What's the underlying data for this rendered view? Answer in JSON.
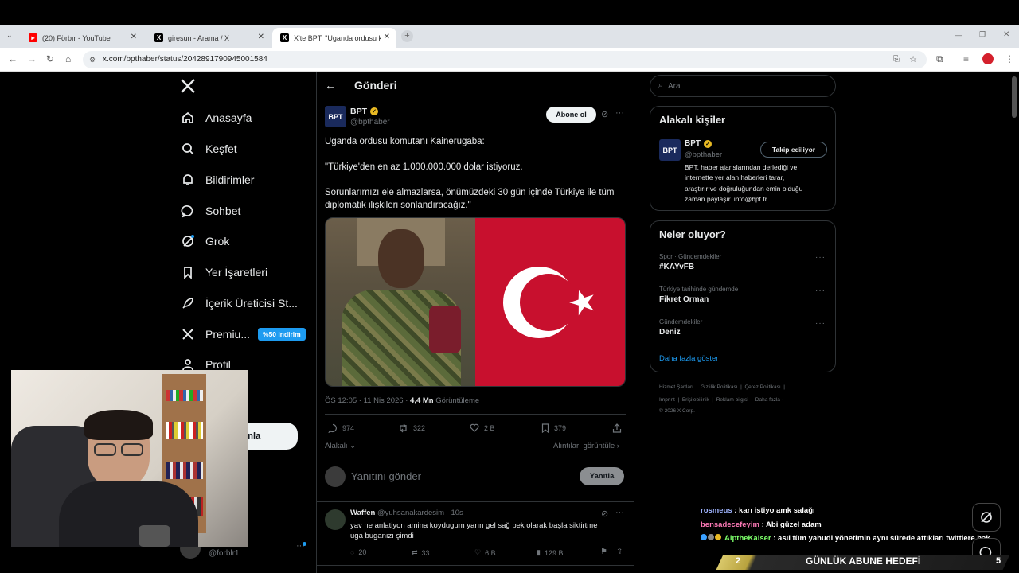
{
  "browser": {
    "tabs": [
      {
        "title": "(20) Förbır - YouTube",
        "icon": "youtube-icon"
      },
      {
        "title": "giresun - Arama / X",
        "icon": "x-icon"
      },
      {
        "title": "X'te BPT: \"Uganda ordusu komu",
        "icon": "x-icon"
      }
    ],
    "url": "x.com/bpthaber/status/2042891790945001584"
  },
  "nav": {
    "items": [
      {
        "label": "Anasayfa",
        "icon": "home-icon"
      },
      {
        "label": "Keşfet",
        "icon": "search-icon"
      },
      {
        "label": "Bildirimler",
        "icon": "bell-icon"
      },
      {
        "label": "Sohbet",
        "icon": "chat-icon"
      },
      {
        "label": "Grok",
        "icon": "grok-icon"
      },
      {
        "label": "Yer İşaretleri",
        "icon": "bookmark-icon"
      },
      {
        "label": "İçerik Üreticisi St...",
        "icon": "rocket-icon"
      },
      {
        "label": "Premiu...",
        "icon": "x-premium-icon"
      },
      {
        "label": "Profil",
        "icon": "profile-icon"
      },
      {
        "label": "la",
        "icon": "more-icon"
      }
    ],
    "premium_badge": "%50 indirim",
    "post_button_partial": "ayınla",
    "account_handle": "@forblr1"
  },
  "header": {
    "title": "Gönderi"
  },
  "post": {
    "author_name": "BPT",
    "author_handle": "@bpthaber",
    "avatar_text": "BPT",
    "subscribe_label": "Abone ol",
    "text_lines": [
      "Uganda ordusu komutanı Kainerugaba:",
      "\"Türkiye'den en az 1.000.000.000 dolar istiyoruz.",
      "Sorunlarımızı ele almazlarsa, önümüzdeki 30 gün içinde Türkiye ile tüm",
      "diplomatik ilişkileri sonlandıracağız.\""
    ],
    "time": "ÖS 12:05 · 11 Nis 2026 · ",
    "views": "4,4 Mn",
    "views_label": " Görüntüleme",
    "replies": "974",
    "reposts": "322",
    "likes": "2 B",
    "bookmarks": "379",
    "related_label": "Alakalı",
    "quotes_label": "Alıntıları görüntüle",
    "reply_placeholder": "Yanıtını gönder",
    "reply_button": "Yanıtla"
  },
  "reply": {
    "name": "Waffen",
    "handle": "@yuhsanakardesim · 10s",
    "text_lines": [
      "yav ne anlatiyon amina koydugum yarın gel sağ bek olarak başla siktirtme",
      "uga buganızı şimdi"
    ],
    "replies": "20",
    "reposts": "33",
    "likes": "6 B",
    "views": "129 B"
  },
  "sidebar": {
    "search_placeholder": "Ara",
    "related_title": "Alakalı kişiler",
    "related_person": {
      "name": "BPT",
      "handle": "@bpthaber",
      "button": "Takip ediliyor",
      "bio_lines": [
        "BPT, haber ajanslarından derlediği ve",
        "internette yer alan haberleri tarar,",
        "araştırır ve doğruluğundan emin olduğu",
        "zaman paylaşır. info@bpt.tr"
      ]
    },
    "trends_title": "Neler oluyor?",
    "trends": [
      {
        "context": "Spor · Gündemdekiler",
        "title": "#KAYvFB"
      },
      {
        "context": "Türkiye tarihinde gündemde",
        "title": "Fikret Orman"
      },
      {
        "context": "Gündemdekiler",
        "title": "Deniz"
      }
    ],
    "show_more": "Daha fazla göster",
    "footer_row1": [
      "Hizmet Şartları",
      "|",
      "Gizlilik Politikası",
      "|",
      "Çerez Politikası",
      "|"
    ],
    "footer_row2": [
      "Imprint",
      "|",
      "Erişilebilirlik",
      "|",
      "Reklam bilgisi",
      "|",
      "Daha fazla ···"
    ],
    "copyright": "© 2026 X Corp."
  },
  "stream_overlay": {
    "chat": [
      {
        "user": "rosmeus",
        "message": " : karı istiyo amk salağı",
        "color": "#9fb4ff"
      },
      {
        "user": "bensadecefeyim",
        "message": " : Abi güzel adam",
        "color": "#ff7ab8"
      },
      {
        "user": "AlptheKaiser",
        "message": " : asıl tüm yahudi yönetimin aynı sürede attıkları twittlere bak",
        "color": "#7dff6a"
      }
    ],
    "goal_current": "2",
    "goal_label": "GÜNLÜK ABUNE HEDEFİ",
    "goal_target": "5"
  },
  "colors": {
    "accent": "#1d9bf0",
    "flag_red": "#c8102e",
    "background": "#000000"
  }
}
